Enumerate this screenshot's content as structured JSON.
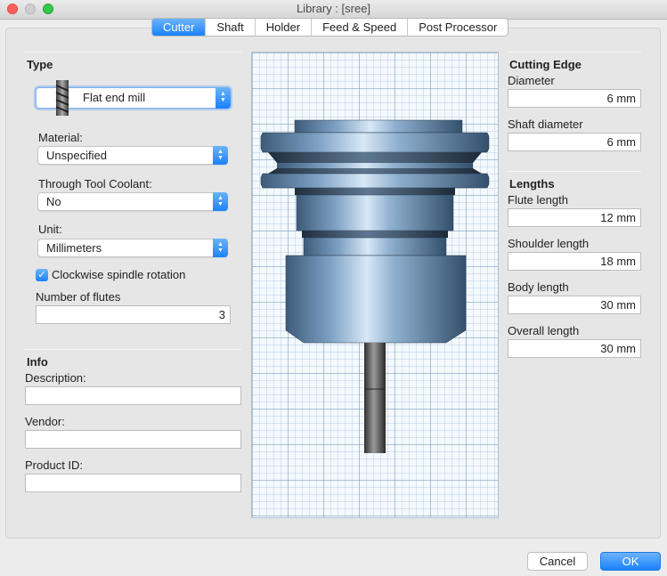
{
  "window": {
    "title": "Library :  [sree]"
  },
  "tabs": [
    "Cutter",
    "Shaft",
    "Holder",
    "Feed & Speed",
    "Post Processor"
  ],
  "type_section": {
    "title": "Type",
    "tool_type": "Flat end mill",
    "material_label": "Material:",
    "material_value": "Unspecified",
    "coolant_label": "Through Tool Coolant:",
    "coolant_value": "No",
    "unit_label": "Unit:",
    "unit_value": "Millimeters",
    "clockwise_label": "Clockwise spindle rotation",
    "clockwise_checked": true,
    "flutes_label": "Number of flutes",
    "flutes_value": "3"
  },
  "info_section": {
    "title": "Info",
    "description_label": "Description:",
    "description_value": "",
    "vendor_label": "Vendor:",
    "vendor_value": "",
    "product_id_label": "Product ID:",
    "product_id_value": ""
  },
  "cutting_edge": {
    "title": "Cutting Edge",
    "diameter_label": "Diameter",
    "diameter_value": "6 mm",
    "shaft_diameter_label": "Shaft diameter",
    "shaft_diameter_value": "6 mm"
  },
  "lengths": {
    "title": "Lengths",
    "flute_label": "Flute length",
    "flute_value": "12 mm",
    "shoulder_label": "Shoulder length",
    "shoulder_value": "18 mm",
    "body_label": "Body length",
    "body_value": "30 mm",
    "overall_label": "Overall length",
    "overall_value": "30 mm"
  },
  "buttons": {
    "cancel": "Cancel",
    "ok": "OK"
  },
  "icons": {
    "popup_arrows": "updown-chevron-icon",
    "checkmark": "checkmark-icon",
    "endmill": "endmill-icon"
  },
  "colors": {
    "accent": "#1a82fb",
    "panel": "#e6e6e6"
  }
}
